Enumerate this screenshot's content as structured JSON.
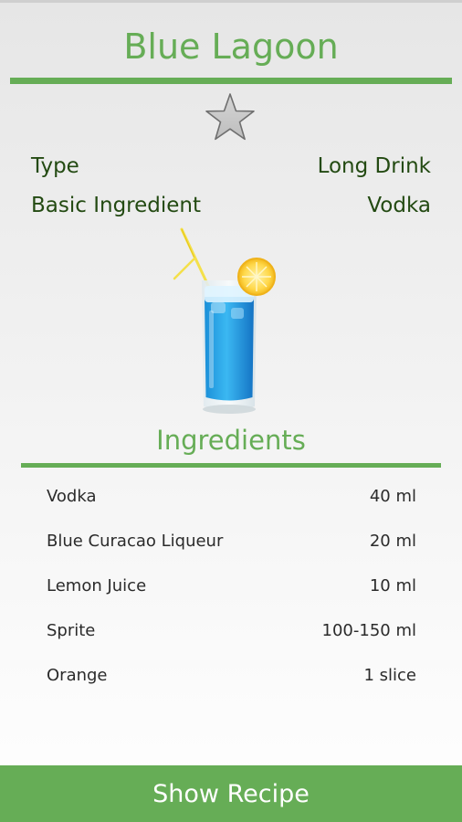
{
  "drink": {
    "name": "Blue Lagoon",
    "type_label": "Type",
    "type_value": "Long Drink",
    "ingredient_label": "Basic Ingredient",
    "ingredient_value": "Vodka",
    "favorite_icon": "star-outline-icon"
  },
  "ingredients": {
    "title": "Ingredients",
    "items": [
      {
        "name": "Vodka",
        "amount": "40 ml"
      },
      {
        "name": "Blue Curacao Liqueur",
        "amount": "20 ml"
      },
      {
        "name": "Lemon Juice",
        "amount": "10 ml"
      },
      {
        "name": "Sprite",
        "amount": "100-150 ml"
      },
      {
        "name": "Orange",
        "amount": "1 slice"
      }
    ]
  },
  "actions": {
    "show_recipe": "Show Recipe"
  },
  "colors": {
    "accent": "#66ad56",
    "label_text": "#234a12"
  }
}
